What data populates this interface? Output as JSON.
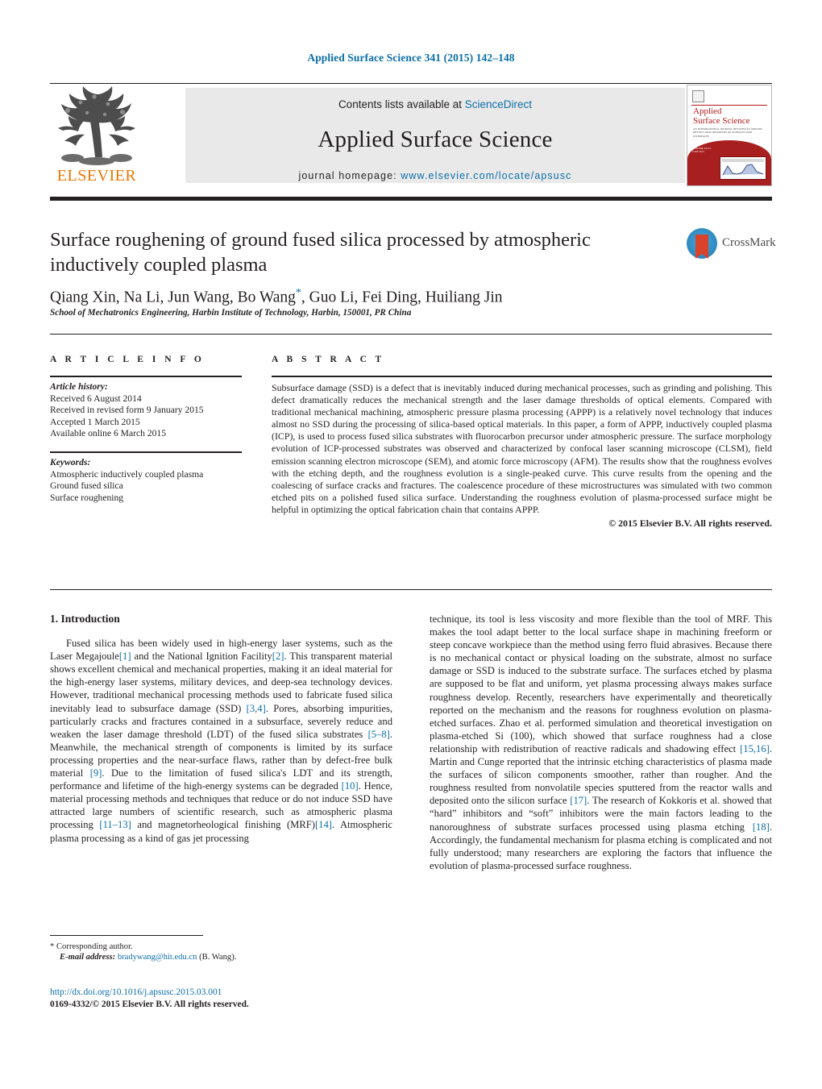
{
  "running_head": "Applied Surface Science 341 (2015) 142–148",
  "masthead": {
    "contents_prefix": "Contents lists available at ",
    "sciencedirect": "ScienceDirect",
    "journal_title": "Applied Surface Science",
    "homepage_prefix": "journal homepage:",
    "homepage_url": "www.elsevier.com/locate/apsusc",
    "publisher": "ELSEVIER",
    "cover": {
      "title_line1": "Applied",
      "title_line2": "Surface Science",
      "subtitle": "AN INTERNATIONAL JOURNAL DEVOTED TO APPLIED PHYSICS AND CHEMISTRY OF SURFACES AND INTERFACES",
      "volume_line": "VOLUME 341  15 JUNE 2015"
    }
  },
  "article": {
    "title": "Surface roughening of ground fused silica processed by atmospheric inductively coupled plasma",
    "authors_before_star": "Qiang Xin, Na Li, Jun Wang, Bo Wang",
    "corresponding_star": "*",
    "authors_after_star": ", Guo Li, Fei Ding, Huiliang Jin",
    "affiliation": "School of Mechatronics Engineering, Harbin Institute of Technology, Harbin, 150001, PR China",
    "crossmark_label": "CrossMark"
  },
  "info": {
    "heading": "A R T I C L E    I N F O",
    "history_label": "Article history:",
    "history": [
      "Received 6 August 2014",
      "Received in revised form 9 January 2015",
      "Accepted 1 March 2015",
      "Available online 6 March 2015"
    ],
    "keywords_label": "Keywords:",
    "keywords": [
      "Atmospheric inductively coupled plasma",
      "Ground fused silica",
      "Surface roughening"
    ]
  },
  "abstract": {
    "heading": "A B S T R A C T",
    "text": "Subsurface damage (SSD) is a defect that is inevitably induced during mechanical processes, such as grinding and polishing. This defect dramatically reduces the mechanical strength and the laser damage thresholds of optical elements. Compared with traditional mechanical machining, atmospheric pressure plasma processing (APPP) is a relatively novel technology that induces almost no SSD during the processing of silica-based optical materials. In this paper, a form of APPP, inductively coupled plasma (ICP), is used to process fused silica substrates with fluorocarbon precursor under atmospheric pressure. The surface morphology evolution of ICP-processed substrates was observed and characterized by confocal laser scanning microscope (CLSM), field emission scanning electron microscope (SEM), and atomic force microscopy (AFM). The results show that the roughness evolves with the etching depth, and the roughness evolution is a single-peaked curve. This curve results from the opening and the coalescing of surface cracks and fractures. The coalescence procedure of these microstructures was simulated with two common etched pits on a polished fused silica surface. Understanding the roughness evolution of plasma-processed surface might be helpful in optimizing the optical fabrication chain that contains APPP.",
    "copyright": "© 2015 Elsevier B.V. All rights reserved."
  },
  "body": {
    "section_number_title": "1.  Introduction",
    "left_p1_a": "Fused silica has been widely used in high-energy laser systems, such as the Laser Megajoule",
    "ref1": "[1]",
    "left_p1_b": " and the National Ignition Facility",
    "ref2": "[2]",
    "left_p1_c": ". This transparent material shows excellent chemical and mechanical properties, making it an ideal material for the high-energy laser systems, military devices, and deep-sea technology devices. However, traditional mechanical processing methods used to fabricate fused silica inevitably lead to subsurface damage (SSD) ",
    "ref34": "[3,4]",
    "left_p1_d": ". Pores, absorbing impurities, particularly cracks and fractures contained in a subsurface, severely reduce and weaken the laser damage threshold (LDT) of the fused silica substrates ",
    "ref58": "[5–8]",
    "left_p1_e": ". Meanwhile, the mechanical strength of components is limited by its surface processing properties and the near-surface flaws, rather than by defect-free bulk material ",
    "ref9": "[9]",
    "left_p1_f": ". Due to the limitation of fused silica's LDT and its strength, performance and lifetime of the high-energy systems can be degraded ",
    "ref10": "[10]",
    "left_p1_g": ". Hence, material processing methods and techniques that reduce or do not induce SSD have attracted large numbers of scientific research, such as atmospheric plasma processing ",
    "ref1113": "[11–13]",
    "left_p1_h": " and magnetorheological finishing (MRF)",
    "ref14": "[14]",
    "left_p1_i": ". Atmospheric plasma processing as a kind of gas jet processing",
    "right_p1_a": "technique, its tool is less viscosity and more flexible than the tool of MRF. This makes the tool adapt better to the local surface shape in machining freeform or steep concave workpiece than the method using ferro fluid abrasives. Because there is no mechanical contact or physical loading on the substrate, almost no surface damage or SSD is induced to the substrate surface. The surfaces etched by plasma are supposed to be flat and uniform, yet plasma processing always makes surface roughness develop. Recently, researchers have experimentally and theoretically reported on the mechanism and the reasons for roughness evolution on plasma-etched surfaces. Zhao et al. performed simulation and theoretical investigation on plasma-etched Si (100), which showed that surface roughness had a close relationship with redistribution of reactive radicals and shadowing effect ",
    "ref1516": "[15,16]",
    "right_p1_b": ". Martin and Cunge reported that the intrinsic etching characteristics of plasma made the surfaces of silicon components smoother, rather than rougher. And the roughness resulted from nonvolatile species sputtered from the reactor walls and deposited onto the silicon surface ",
    "ref17": "[17]",
    "right_p1_c": ". The research of Kokkoris et al. showed that “hard” inhibitors and “soft” inhibitors were the main factors leading to the nanoroughness of substrate surfaces processed using plasma etching ",
    "ref18": "[18]",
    "right_p1_d": ". Accordingly, the fundamental mechanism for plasma etching is complicated and not fully understood; many researchers are exploring the factors that influence the evolution of plasma-processed surface roughness."
  },
  "footer": {
    "corresponding_marker": "*",
    "corresponding_text": "Corresponding author.",
    "email_label": "E-mail address:",
    "email": "bradywang@hit.edu.cn",
    "email_owner": "(B. Wang).",
    "doi": "http://dx.doi.org/10.1016/j.apsusc.2015.03.001",
    "issn_line": "0169-4332/© 2015 Elsevier B.V. All rights reserved."
  },
  "colors": {
    "link": "#0b6ea8",
    "elsevier_orange": "#ea7600",
    "cover_red": "#a81f1f"
  }
}
